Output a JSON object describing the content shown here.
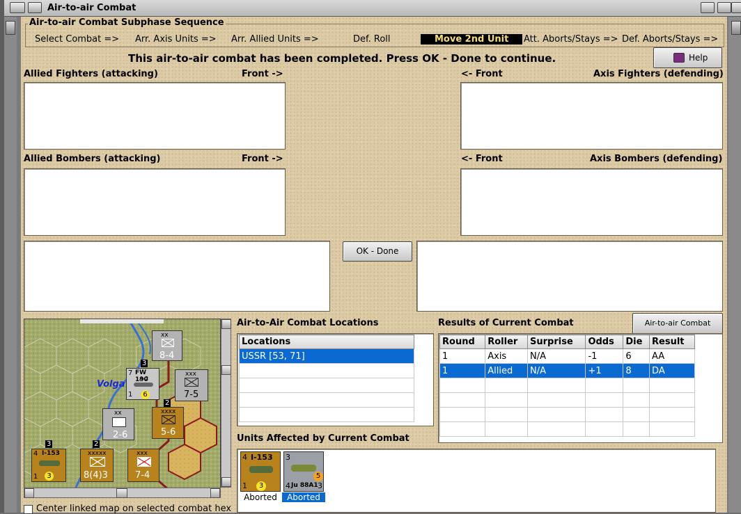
{
  "window": {
    "title": "Air-to-air Combat"
  },
  "subphase": {
    "title": "Air-to-air Combat Subphase Sequence",
    "steps": [
      {
        "label": "Select Combat =>"
      },
      {
        "label": "Arr. Axis Units =>"
      },
      {
        "label": "Arr. Allied Units =>"
      },
      {
        "label": "Def. Roll"
      },
      {
        "label": "Move 2nd Unit",
        "active": true
      },
      {
        "label": "Att. Aborts/Stays =>"
      },
      {
        "label": "Def. Aborts/Stays =>"
      }
    ]
  },
  "status_message": "This air-to-air combat has been completed.  Press OK - Done to continue.",
  "help_label": "Help",
  "allied_fighters": {
    "title": "Allied Fighters (attacking)",
    "front": "Front ->"
  },
  "axis_fighters": {
    "title": "Axis Fighters (defending)",
    "front": "<- Front"
  },
  "allied_bombers": {
    "title": "Allied Bombers (attacking)",
    "front": "Front ->"
  },
  "axis_bombers": {
    "title": "Axis Bombers (defending)",
    "front": "<- Front"
  },
  "ok_button": "OK - Done",
  "locations": {
    "section_title": "Air-to-Air Combat Locations",
    "header": "Locations",
    "rows": [
      "USSR [53, 71]"
    ]
  },
  "results": {
    "section_title": "Results of Current Combat",
    "chart_button": "Air-to-air Combat Chart",
    "columns": [
      "Round",
      "Roller",
      "Surprise",
      "Odds",
      "Die",
      "Result"
    ],
    "rows": [
      [
        "1",
        "Axis",
        "N/A",
        "-1",
        "6",
        "AA"
      ],
      [
        "1",
        "Allied",
        "N/A",
        "+1",
        "8",
        "DA"
      ]
    ]
  },
  "units_affected": {
    "section_title": "Units Affected by Current Combat",
    "units": [
      {
        "name": "I-153",
        "left": "4",
        "bottom_left": "1",
        "bottom_mid": "3",
        "status": "Aborted",
        "color": "#b8821c"
      },
      {
        "name": "Ju 88A1",
        "left": "3",
        "bottom_left": "4",
        "bottom_right": "3",
        "badge": "5",
        "status": "Aborted",
        "color": "#9aa0a6"
      }
    ]
  },
  "map": {
    "river_label": "Volga",
    "counters": [
      {
        "type": "xx",
        "strength": "8-4"
      },
      {
        "type": "xxx",
        "strength": "7-5"
      },
      {
        "type": "xxxx",
        "strength": "5-6"
      },
      {
        "type": "xxxxx",
        "strength": "8(4)3"
      },
      {
        "type": "xxx",
        "strength": "7-4"
      },
      {
        "type": "xx",
        "strength": "2-6"
      }
    ],
    "fw190": {
      "name": "FW 190",
      "sub": "A-2",
      "left": "7",
      "bottom_left": "1",
      "badge": "6"
    },
    "i153": {
      "name": "I-153",
      "left": "4",
      "bottom_left": "1",
      "badge": "3"
    },
    "stack_numbers": [
      "3",
      "2",
      "3",
      "2"
    ]
  },
  "center_map_checkbox": "Center linked map on selected combat hex"
}
